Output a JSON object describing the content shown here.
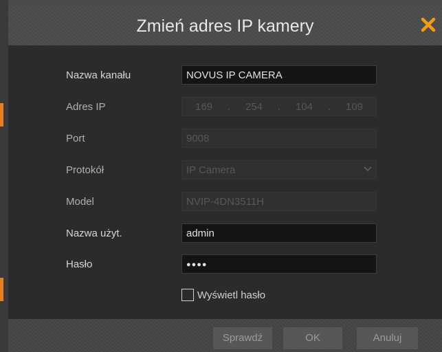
{
  "dialog": {
    "title": "Zmień adres IP kamery"
  },
  "fields": {
    "channel_name": {
      "label": "Nazwa kanału",
      "value": "NOVUS IP CAMERA"
    },
    "ip_address": {
      "label": "Adres IP",
      "octets": [
        "169",
        "254",
        "104",
        "109"
      ],
      "separator": "."
    },
    "port": {
      "label": "Port",
      "value": "9008"
    },
    "protocol": {
      "label": "Protokół",
      "value": "IP Camera"
    },
    "model": {
      "label": "Model",
      "value": "NVIP-4DN3511H"
    },
    "username": {
      "label": "Nazwa użyt.",
      "value": "admin"
    },
    "password": {
      "label": "Hasło",
      "value": "●●●●"
    }
  },
  "show_password": {
    "label": "Wyświetl hasło",
    "checked": false
  },
  "buttons": {
    "check": "Sprawdź",
    "ok": "OK",
    "cancel": "Anuluj"
  },
  "icons": {
    "close": "close-icon",
    "dropdown": "chevron-down-icon"
  },
  "colors": {
    "accent": "#f39c12",
    "background": "#2b2b2b",
    "input_active": "#141414"
  }
}
